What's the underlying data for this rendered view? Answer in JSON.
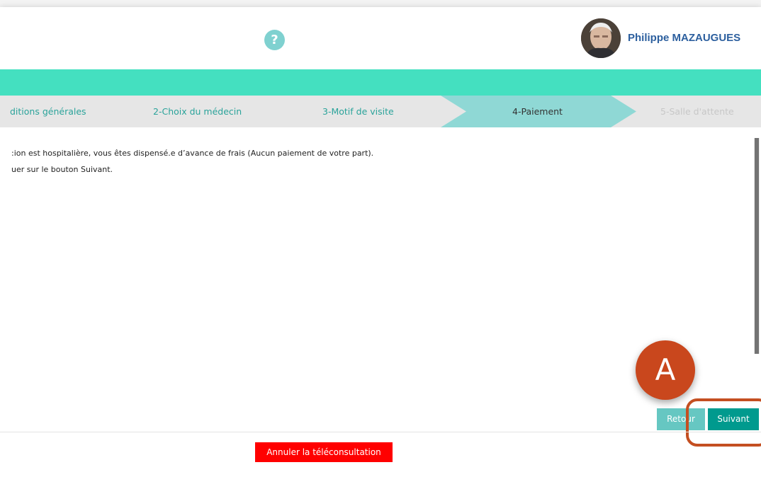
{
  "header": {
    "help_icon": "?",
    "user_name": "Philippe MAZAUGUES"
  },
  "steps": [
    {
      "label": "ditions générales",
      "state": "done"
    },
    {
      "label": "2-Choix du médecin",
      "state": "done"
    },
    {
      "label": "3-Motif de visite",
      "state": "done"
    },
    {
      "label": "4-Paiement",
      "state": "active"
    },
    {
      "label": "5-Salle d'attente",
      "state": "pending"
    }
  ],
  "content": {
    "line1": ":ion est hospitalière, vous êtes dispensé.e d’avance de frais (Aucun paiement de votre part).",
    "line2": "uer sur le bouton Suivant."
  },
  "buttons": {
    "retour": "Retour",
    "suivant": "Suivant",
    "annuler": "Annuler la téléconsultation"
  },
  "annotation": {
    "marker": "A"
  },
  "colors": {
    "accent_teal": "#44e0c0",
    "step_active": "#8fd8d5",
    "primary_button": "#009a8e",
    "secondary_button": "#66c7c2",
    "cancel_button": "#ff0000",
    "annotation": "#c9471d"
  }
}
